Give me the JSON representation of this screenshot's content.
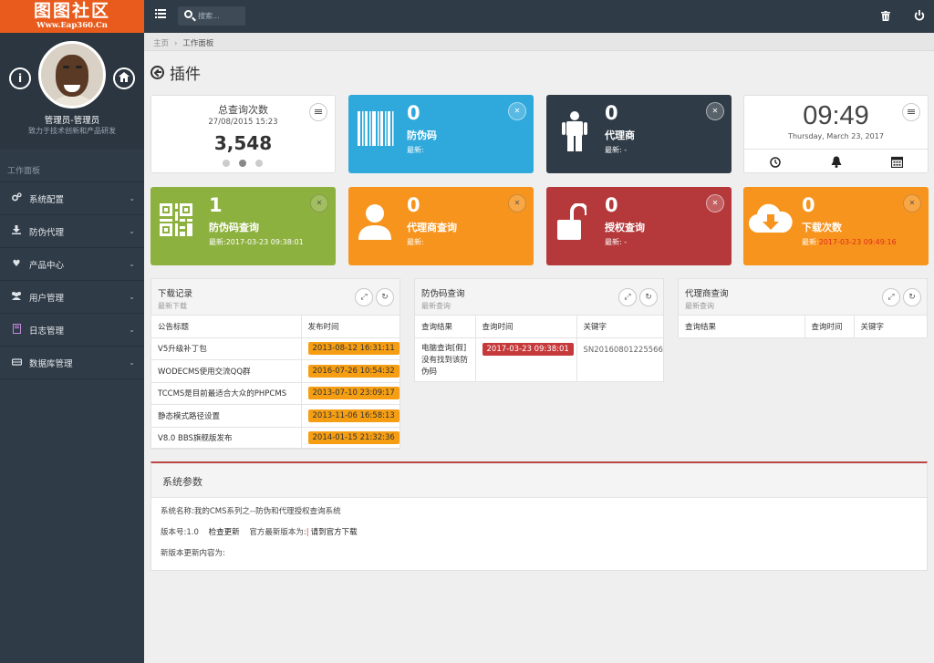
{
  "logo": {
    "title": "图图社区",
    "site": "Www.Eap360.Cn"
  },
  "profile": {
    "name": "管理员-管理员",
    "subtitle": "致力于技术创新和产品研发",
    "info_icon": "info-icon",
    "home_icon": "home-icon"
  },
  "sidebar": {
    "section": "工作面板",
    "items": [
      {
        "label": "系统配置",
        "icon": "cogs-icon"
      },
      {
        "label": "防伪代理",
        "icon": "download-icon"
      },
      {
        "label": "产品中心",
        "icon": "heart-icon"
      },
      {
        "label": "用户管理",
        "icon": "users-icon"
      },
      {
        "label": "日志管理",
        "icon": "book-icon"
      },
      {
        "label": "数据库管理",
        "icon": "database-icon"
      }
    ]
  },
  "topbar": {
    "search_placeholder": "搜索..."
  },
  "breadcrumb": {
    "home": "主页",
    "sep": "›",
    "current": "工作面板"
  },
  "page": {
    "title": "插件"
  },
  "tiles": {
    "total": {
      "title": "总查询次数",
      "datetime": "27/08/2015 15:23",
      "value": "3,548"
    },
    "barcode": {
      "value": "0",
      "name": "防伪码",
      "latest": "最新:",
      "color": "#2fa9dc"
    },
    "agent": {
      "value": "0",
      "name": "代理商",
      "latest": "最新: -",
      "color": "#2f3b47"
    },
    "clock": {
      "time": "09:49",
      "date": "Thursday, March 23, 2017"
    },
    "qr_query": {
      "value": "1",
      "name": "防伪码查询",
      "latest": "最新:2017-03-23 09:38:01",
      "color": "#8db13f"
    },
    "agent_query": {
      "value": "0",
      "name": "代理商查询",
      "latest": "最新:",
      "color": "#f7941d"
    },
    "auth_query": {
      "value": "0",
      "name": "授权查询",
      "latest": "最新: -",
      "color": "#b5393b"
    },
    "downloads": {
      "value": "0",
      "name": "下载次数",
      "latest_label": "最新:",
      "latest_value": "2017-03-23 09:49:16",
      "color": "#f7941d"
    }
  },
  "download_panel": {
    "title": "下载记录",
    "subtitle": "最新下载",
    "headers": [
      "公告标题",
      "发布时间"
    ],
    "rows": [
      {
        "title": "V5升级补丁包",
        "time": "2013-08-12 16:31:11"
      },
      {
        "title": "WODECMS使用交流QQ群",
        "time": "2016-07-26 10:54:32"
      },
      {
        "title": "TCCMS是目前最适合大众的PHPCMS",
        "time": "2013-07-10 23:09:17"
      },
      {
        "title": "静态模式路径设置",
        "time": "2013-11-06 16:58:13"
      },
      {
        "title": "V8.0 BBS旗舰版发布",
        "time": "2014-01-15 21:32:36"
      }
    ]
  },
  "code_panel": {
    "title": "防伪码查询",
    "subtitle": "最新查询",
    "headers": [
      "查询结果",
      "查询时间",
      "关键字"
    ],
    "row": {
      "result": "电脑查询[假]没有找到该防伪码",
      "time": "2017-03-23 09:38:01",
      "keyword": "SN20160801225566"
    }
  },
  "agent_panel": {
    "title": "代理商查询",
    "subtitle": "最新查询",
    "headers": [
      "查询结果",
      "查询时间",
      "关键字"
    ]
  },
  "sys_panel": {
    "title": "系统参数",
    "name_line": "系统名称:我的CMS系列之--防伪和代理授权查询系统",
    "version": "版本号:1.0",
    "check_update": "检查更新",
    "latest_version": "官方最新版本为:",
    "download_link": "请到官方下载",
    "update_content": "新版本更新内容为:"
  }
}
